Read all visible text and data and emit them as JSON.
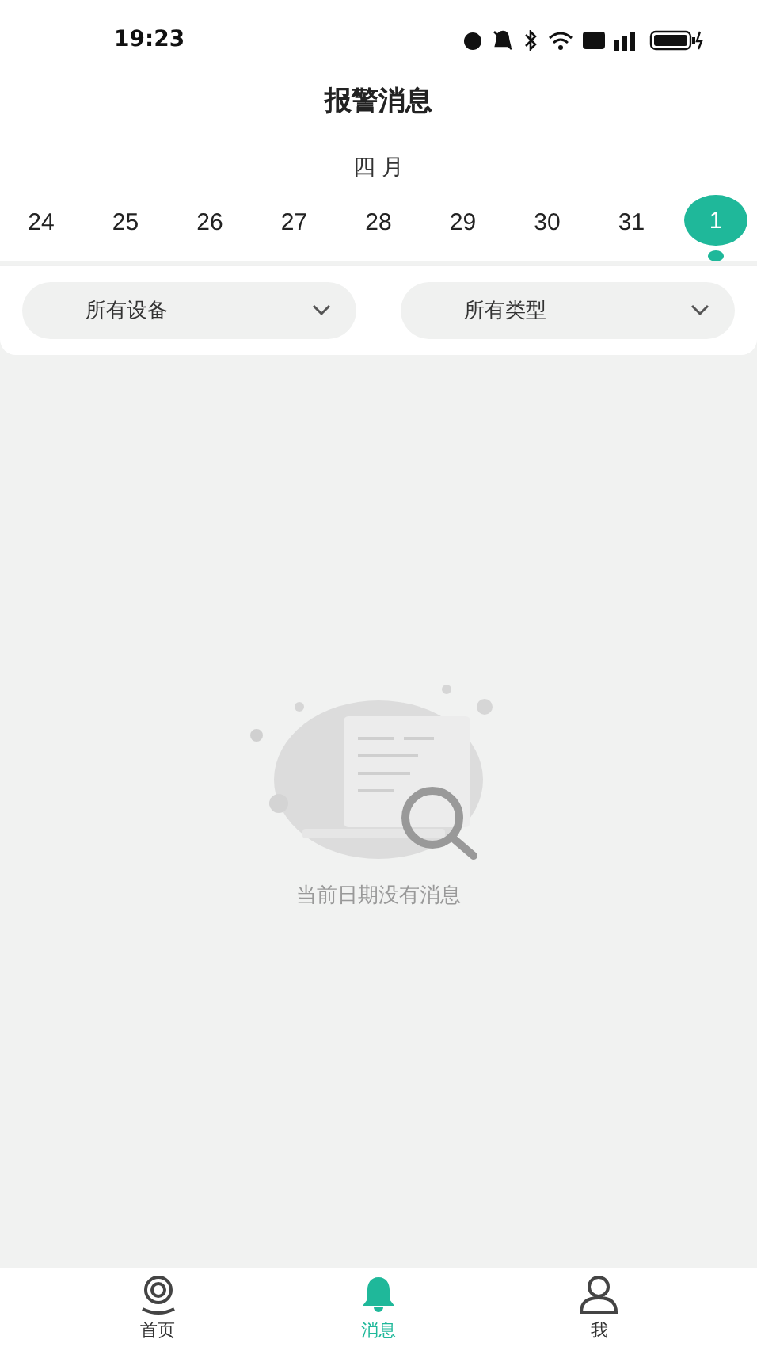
{
  "status_bar": {
    "time": "19:23"
  },
  "title": "报警消息",
  "month": "四 月",
  "dates": [
    {
      "label": "24",
      "selected": false
    },
    {
      "label": "25",
      "selected": false
    },
    {
      "label": "26",
      "selected": false
    },
    {
      "label": "27",
      "selected": false
    },
    {
      "label": "28",
      "selected": false
    },
    {
      "label": "29",
      "selected": false
    },
    {
      "label": "30",
      "selected": false
    },
    {
      "label": "31",
      "selected": false
    },
    {
      "label": "1",
      "selected": true
    }
  ],
  "filters": [
    "所有设备",
    "所有类型"
  ],
  "empty_message": "当前日期没有消息",
  "nav": [
    {
      "label": "首页",
      "kind": "home",
      "selected": false
    },
    {
      "label": "消息",
      "kind": "bell",
      "selected": true
    },
    {
      "label": "我",
      "kind": "person",
      "selected": false
    }
  ]
}
